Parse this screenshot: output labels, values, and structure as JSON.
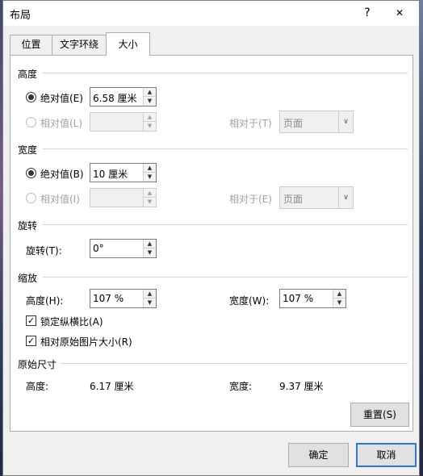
{
  "window": {
    "title": "布局",
    "help_label": "?",
    "close_label": "✕"
  },
  "tabs": [
    {
      "label": "位置"
    },
    {
      "label": "文字环绕"
    },
    {
      "label": "大小"
    }
  ],
  "height_section": {
    "title": "高度",
    "absolute": {
      "label": "绝对值(E)",
      "value": "6.58 厘米"
    },
    "relative": {
      "label": "相对值(L)",
      "value": ""
    },
    "relative_to": {
      "label": "相对于(T)",
      "value": "页面"
    }
  },
  "width_section": {
    "title": "宽度",
    "absolute": {
      "label": "绝对值(B)",
      "value": "10 厘米"
    },
    "relative": {
      "label": "相对值(I)",
      "value": ""
    },
    "relative_to": {
      "label": "相对于(E)",
      "value": "页面"
    }
  },
  "rotation_section": {
    "title": "旋转",
    "rotation": {
      "label": "旋转(T):",
      "value": "0°"
    }
  },
  "scale_section": {
    "title": "缩放",
    "height": {
      "label": "高度(H):",
      "value": "107 %"
    },
    "width": {
      "label": "宽度(W):",
      "value": "107 %"
    },
    "lock_aspect": {
      "label": "锁定纵横比(A)",
      "checked": true
    },
    "relative_original": {
      "label": "相对原始图片大小(R)",
      "checked": true
    }
  },
  "original_section": {
    "title": "原始尺寸",
    "height_label": "高度:",
    "height_value": "6.17 厘米",
    "width_label": "宽度:",
    "width_value": "9.37 厘米"
  },
  "buttons": {
    "reset": "重置(S)",
    "ok": "确定",
    "cancel": "取消"
  },
  "glyphs": {
    "up": "▲",
    "down": "▼",
    "check": "✓",
    "dropdown": "∨"
  }
}
